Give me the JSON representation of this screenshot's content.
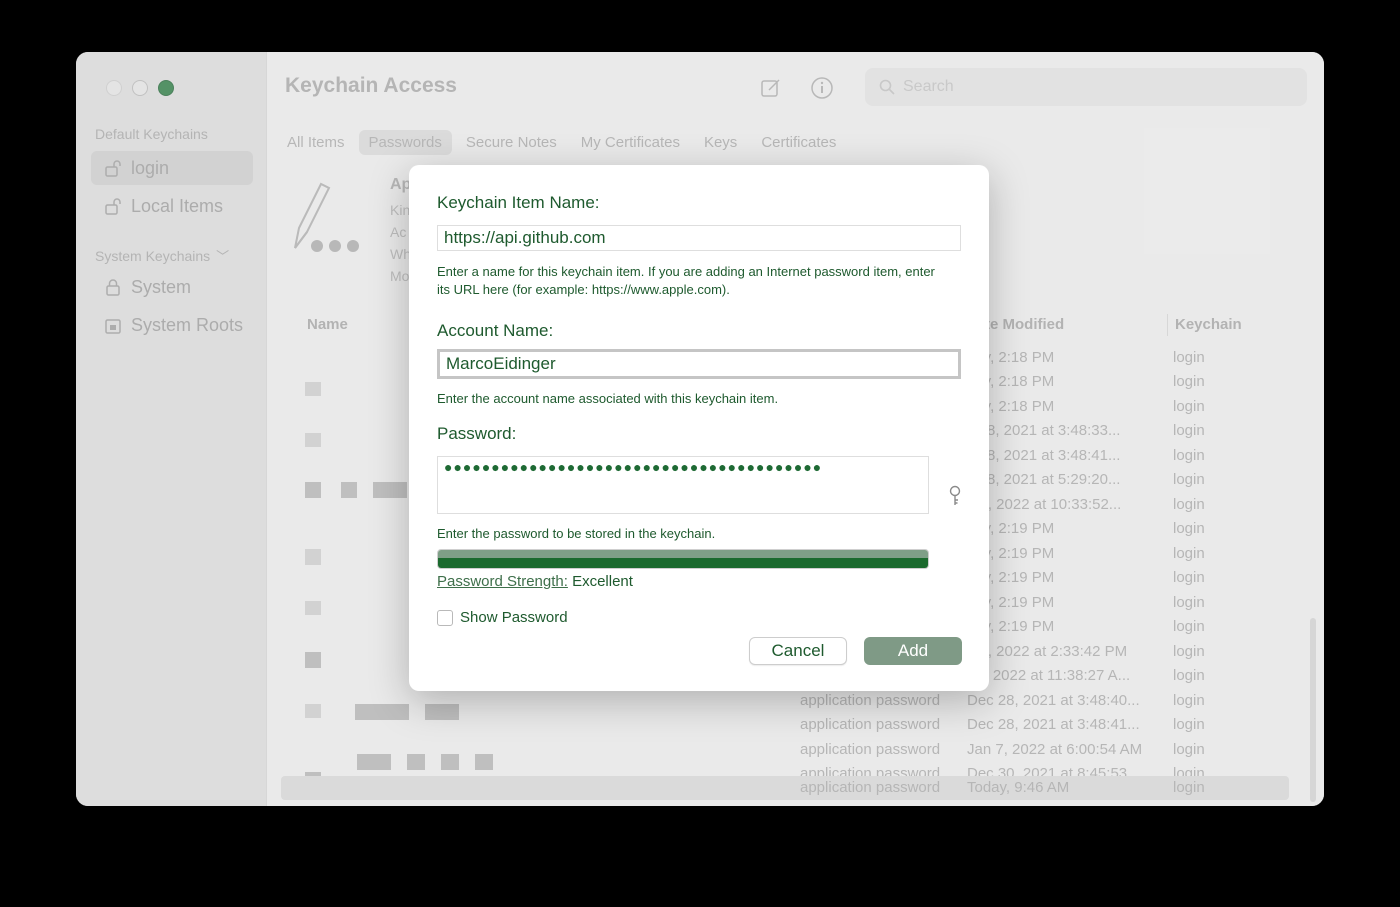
{
  "app": {
    "title": "Keychain Access"
  },
  "sidebar": {
    "default_header": "Default Keychains",
    "system_header": "System Keychains",
    "items": [
      {
        "label": "login",
        "icon": "lock-open-icon",
        "selected": true
      },
      {
        "label": "Local Items",
        "icon": "lock-open-icon"
      },
      {
        "label": "System",
        "icon": "lock-icon"
      },
      {
        "label": "System Roots",
        "icon": "lock-icon"
      }
    ]
  },
  "toolbar": {
    "search_placeholder": "Search"
  },
  "tabs": [
    "All Items",
    "Passwords",
    "Secure Notes",
    "My Certificates",
    "Keys",
    "Certificates"
  ],
  "active_tab": "Passwords",
  "detail": {
    "title_prefix": "Ap",
    "lines": [
      "Kin",
      "Ac",
      "Wh",
      "Mo"
    ]
  },
  "columns": {
    "name": "Name",
    "date_modified_partial": "te Modified",
    "keychain": "Keychain"
  },
  "rows": [
    {
      "kind": "",
      "date": "day, 2:18 PM",
      "keychain": "login"
    },
    {
      "kind": "",
      "date": "day, 2:18 PM",
      "keychain": "login"
    },
    {
      "kind": "",
      "date": "day, 2:18 PM",
      "keychain": "login"
    },
    {
      "kind": "",
      "date": "c 28, 2021 at 3:48:33...",
      "keychain": "login"
    },
    {
      "kind": "",
      "date": "c 28, 2021 at 3:48:41...",
      "keychain": "login"
    },
    {
      "kind": "",
      "date": "c 28, 2021 at 5:29:20...",
      "keychain": "login"
    },
    {
      "kind": "",
      "date": "b 9, 2022 at 10:33:52...",
      "keychain": "login"
    },
    {
      "kind": "",
      "date": "day, 2:19 PM",
      "keychain": "login"
    },
    {
      "kind": "",
      "date": "day, 2:19 PM",
      "keychain": "login"
    },
    {
      "kind": "",
      "date": "day, 2:19 PM",
      "keychain": "login"
    },
    {
      "kind": "",
      "date": "day, 2:19 PM",
      "keychain": "login"
    },
    {
      "kind": "",
      "date": "day, 2:19 PM",
      "keychain": "login"
    },
    {
      "kind": "",
      "date": "b 2, 2022 at 2:33:42 PM",
      "keychain": "login"
    },
    {
      "kind": "",
      "date": "r 3, 2022 at 11:38:27 A...",
      "keychain": "login"
    },
    {
      "kind": "application password",
      "date": "Dec 28, 2021 at 3:48:40...",
      "keychain": "login"
    },
    {
      "kind": "application password",
      "date": "Dec 28, 2021 at 3:48:41...",
      "keychain": "login"
    },
    {
      "kind": "application password",
      "date": "Jan 7, 2022 at 6:00:54 AM",
      "keychain": "login"
    },
    {
      "kind": "application password",
      "date": "Dec 30, 2021 at 8:45:53...",
      "keychain": "login"
    },
    {
      "kind": "application password",
      "date": "Today, 9:46 AM",
      "keychain": "login"
    }
  ],
  "dialog": {
    "item_name_label": "Keychain Item Name:",
    "item_name_value": "https://api.github.com",
    "item_name_help": "Enter a name for this keychain item. If you are adding an Internet password item, enter its URL here (for example: https://www.apple.com).",
    "account_label": "Account Name:",
    "account_value": "MarcoEidinger",
    "account_help": "Enter the account name associated with this keychain item.",
    "password_label": "Password:",
    "password_masked": "●●●●●●●●●●●●●●●●●●●●●●●●●●●●●●●●●●●●●●●●",
    "password_help": "Enter the password to be stored in the keychain.",
    "strength_label": "Password Strength:",
    "strength_value": "Excellent",
    "strength_fraction": 1.0,
    "show_password_label": "Show Password",
    "show_password_checked": false,
    "cancel_label": "Cancel",
    "add_label": "Add"
  },
  "colors": {
    "accent": "#1e5a2e",
    "add_button": "#7f9a86",
    "zoom_button": "#2f7a45"
  }
}
